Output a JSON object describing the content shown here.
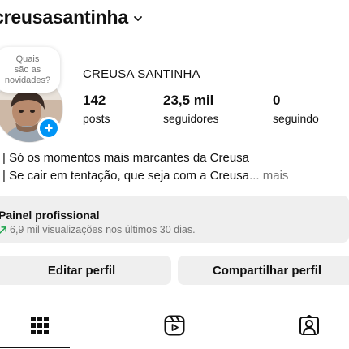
{
  "header": {
    "username": "creusasantinha",
    "username_menu_icon": "chevron-down-icon"
  },
  "note": {
    "line1": "Quais",
    "line2": "são as",
    "line3": "novidades?"
  },
  "profile": {
    "full_name": "CREUSA SANTINHA",
    "add_story_icon": "plus-icon"
  },
  "stats": {
    "posts": {
      "value": "142",
      "label": "posts"
    },
    "followers": {
      "value": "23,5 mil",
      "label": "seguidores"
    },
    "following": {
      "value": "0",
      "label": "seguindo"
    }
  },
  "bio": {
    "line1": "| Só os momentos mais marcantes da Creusa",
    "line2": "| Se cair em tentação, que seja com a Creusa",
    "ellipsis": "...",
    "more_label": "mais"
  },
  "professional_panel": {
    "title": "Painel profissional",
    "subtitle": "6,9 mil visualizações nos últimos 30 dias.",
    "icon": "trending-up-icon"
  },
  "actions": {
    "edit_label": "Editar perfil",
    "share_label": "Compartilhar perfil"
  },
  "tabs": [
    {
      "name": "posts-grid",
      "icon": "grid-icon",
      "active": true
    },
    {
      "name": "reels",
      "icon": "reels-icon",
      "active": false
    },
    {
      "name": "tagged",
      "icon": "tagged-person-icon",
      "active": false
    }
  ],
  "colors": {
    "accent_blue": "#0095f6",
    "trend_green": "#1aa34a",
    "panel_bg": "#efefef",
    "muted_text": "#737373"
  }
}
